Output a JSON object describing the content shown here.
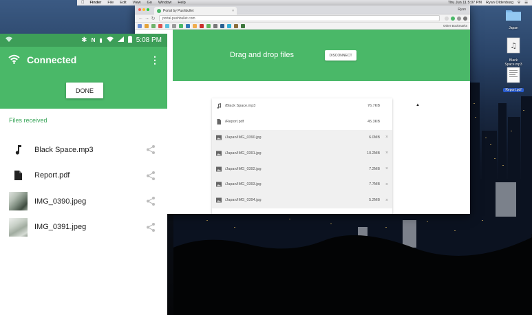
{
  "menubar": {
    "app": "Finder",
    "items": [
      "File",
      "Edit",
      "View",
      "Go",
      "Window",
      "Help"
    ],
    "clock": "Thu Jun 11  5:07 PM",
    "user": "Ryan Oldenburg"
  },
  "desktop_icons": [
    {
      "label": "Japan",
      "icon": "folder-icon"
    },
    {
      "label": "Black Space.mp3",
      "icon": "audio-file-icon"
    },
    {
      "label": "Report.pdf",
      "icon": "pdf-file-icon"
    }
  ],
  "browser": {
    "tab_title": "Portal by Pushbullet",
    "user": "Ryan",
    "url": "portal.pushbullet.com",
    "other_bookmarks": "Other Bookmarks",
    "header_title": "Drag and drop files",
    "disconnect_label": "DISCONNECT",
    "files": [
      {
        "name": "/Black Space.mp3",
        "size": "76.7KB",
        "icon": "music-note-icon",
        "pending": false
      },
      {
        "name": "/Report.pdf",
        "size": "45.3KB",
        "icon": "document-icon",
        "pending": false
      },
      {
        "name": "/Japan/IMG_0390.jpg",
        "size": "6.0MB",
        "icon": "image-icon",
        "pending": true
      },
      {
        "name": "/Japan/IMG_0391.jpg",
        "size": "10.2MB",
        "icon": "image-icon",
        "pending": true
      },
      {
        "name": "/Japan/IMG_0392.jpg",
        "size": "7.2MB",
        "icon": "image-icon",
        "pending": true
      },
      {
        "name": "/Japan/IMG_0393.jpg",
        "size": "7.7MB",
        "icon": "image-icon",
        "pending": true
      },
      {
        "name": "/Japan/IMG_0394.jpg",
        "size": "5.2MB",
        "icon": "image-icon",
        "pending": true
      }
    ]
  },
  "phone": {
    "status_time": "5:08 PM",
    "title": "Connected",
    "done_label": "DONE",
    "received_heading": "Files received",
    "files": [
      {
        "name": "Black Space.mp3",
        "icon": "music-note-icon"
      },
      {
        "name": "Report.pdf",
        "icon": "document-icon"
      },
      {
        "name": "IMG_0390.jpeg",
        "icon": "photo-thumbnail"
      },
      {
        "name": "IMG_0391.jpeg",
        "icon": "photo-thumbnail"
      }
    ]
  },
  "colors": {
    "pushbullet_green": "#4ab868",
    "statusbar_green": "#3d9e58",
    "accent_text_green": "#3aa65a"
  }
}
